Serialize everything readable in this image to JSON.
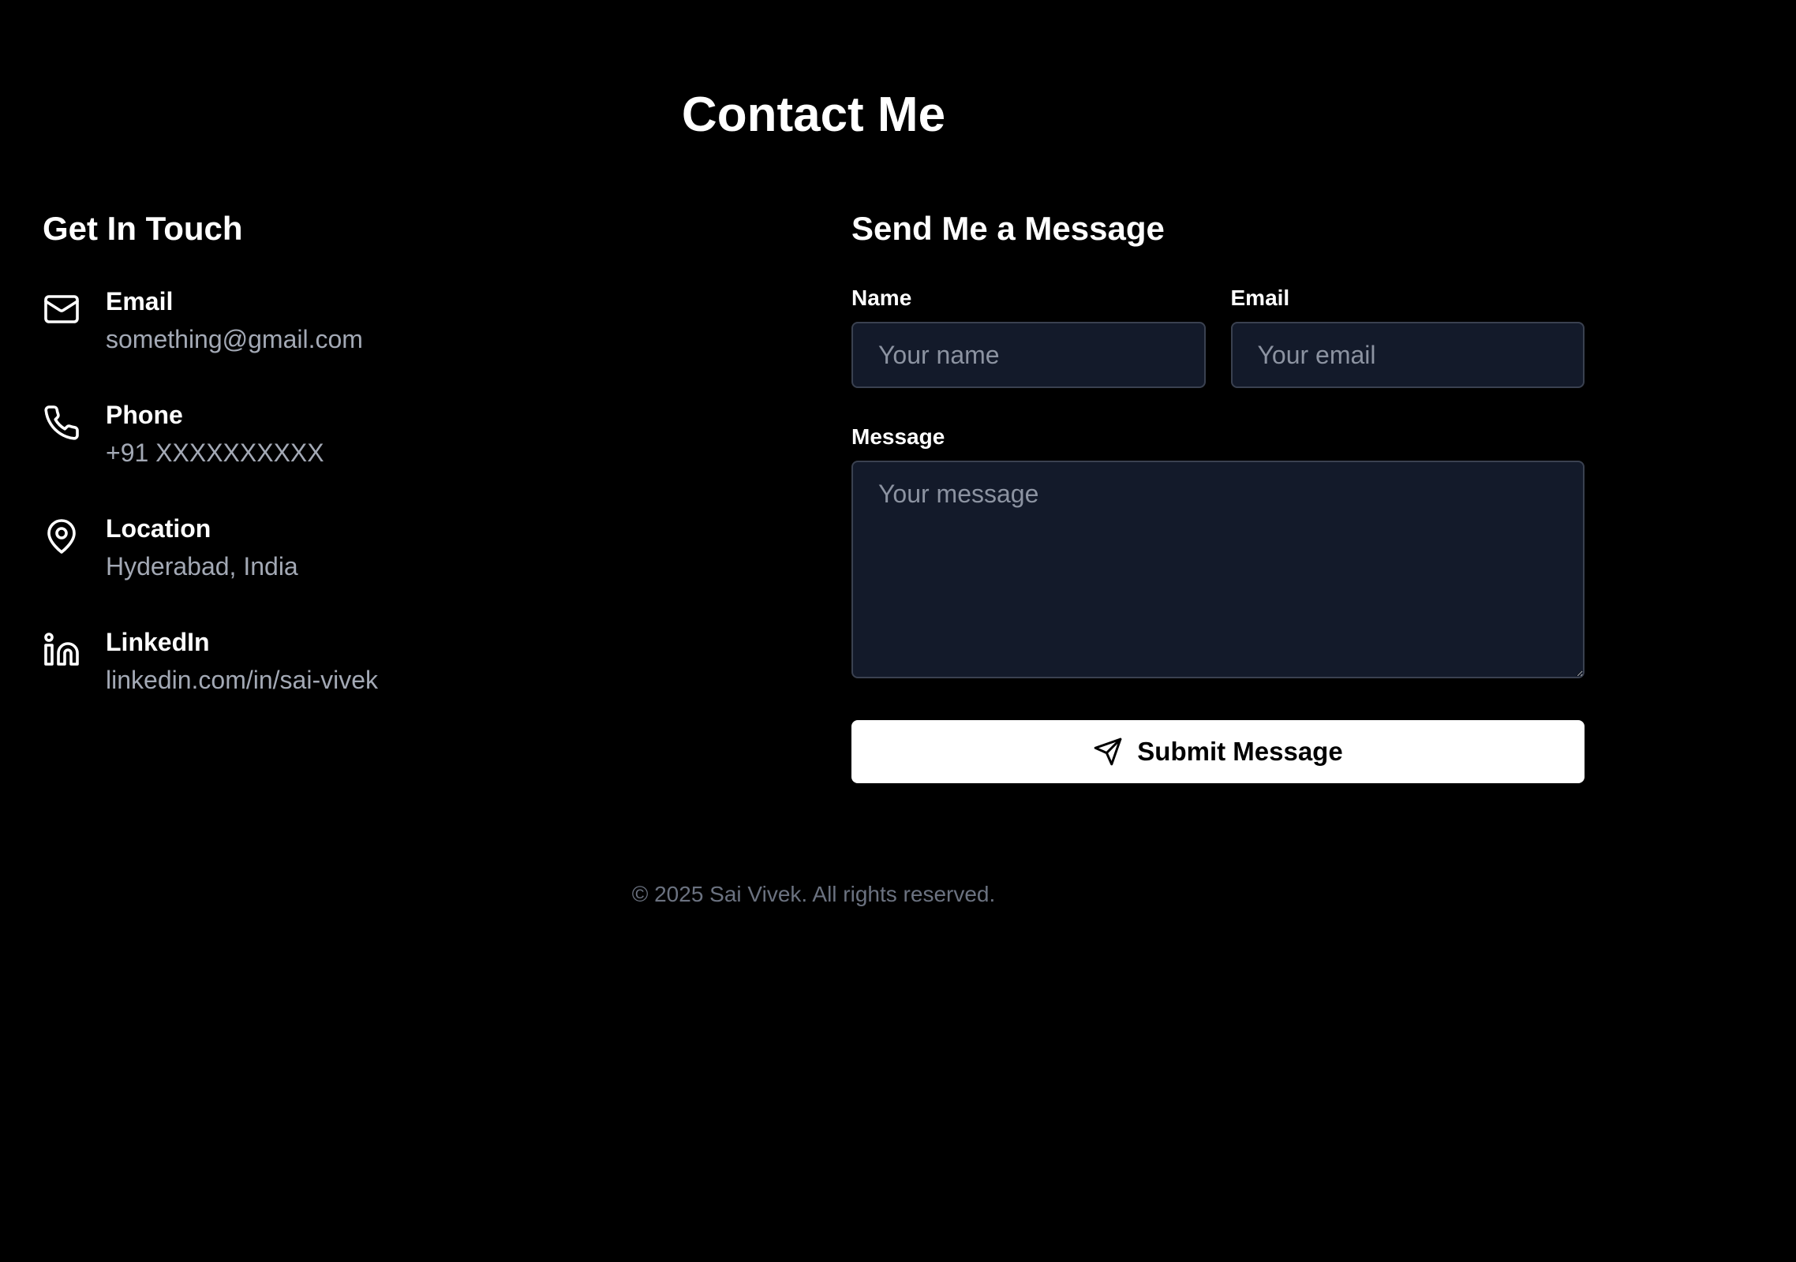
{
  "header": {
    "title": "Contact Me"
  },
  "contact": {
    "heading": "Get In Touch",
    "items": [
      {
        "icon": "mail-icon",
        "label": "Email",
        "value": "something@gmail.com"
      },
      {
        "icon": "phone-icon",
        "label": "Phone",
        "value": "+91 XXXXXXXXXX"
      },
      {
        "icon": "map-pin-icon",
        "label": "Location",
        "value": "Hyderabad, India"
      },
      {
        "icon": "linkedin-icon",
        "label": "LinkedIn",
        "value": "linkedin.com/in/sai-vivek"
      }
    ]
  },
  "form": {
    "heading": "Send Me a Message",
    "name_label": "Name",
    "name_placeholder": "Your name",
    "name_value": "",
    "email_label": "Email",
    "email_placeholder": "Your email",
    "email_value": "",
    "message_label": "Message",
    "message_placeholder": "Your message",
    "message_value": "",
    "submit_label": "Submit Message",
    "submit_icon": "send-icon"
  },
  "footer": {
    "text": "© 2025 Sai Vivek. All rights reserved."
  },
  "colors": {
    "background": "#000000",
    "input_background": "#131a2a",
    "input_border": "#3a4150",
    "muted_text": "#a3a9b5",
    "footer_text": "#6b7280",
    "button_background": "#ffffff"
  }
}
